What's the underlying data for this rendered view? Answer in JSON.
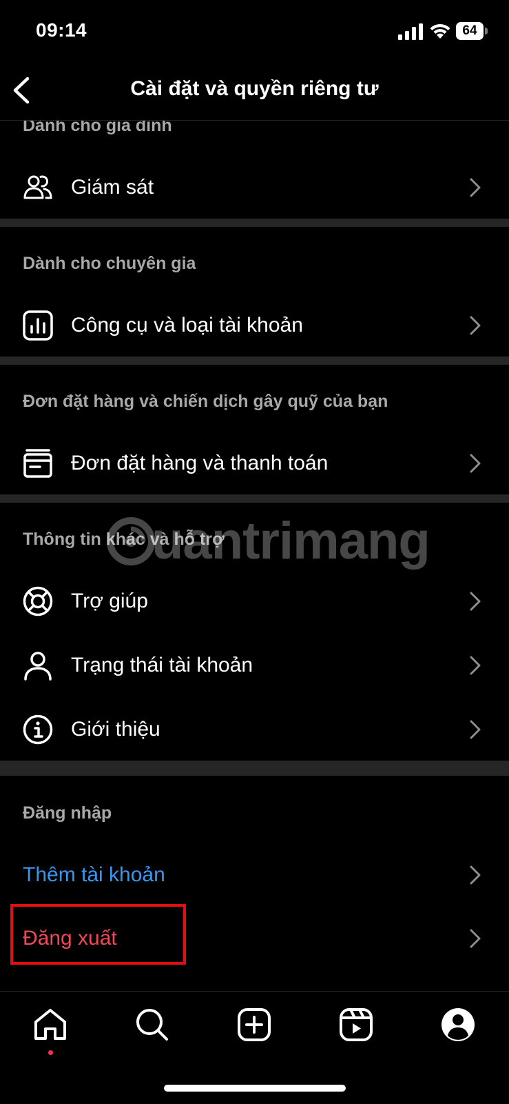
{
  "status": {
    "time": "09:14",
    "battery": "64"
  },
  "header": {
    "title": "Cài đặt và quyền riêng tư"
  },
  "sections": {
    "family": {
      "title": "Dành cho gia đình",
      "item": "Giám sát"
    },
    "pro": {
      "title": "Dành cho chuyên gia",
      "item": "Công cụ và loại tài khoản"
    },
    "orders": {
      "title": "Đơn đặt hàng và chiến dịch gây quỹ của bạn",
      "item": "Đơn đặt hàng và thanh toán"
    },
    "support": {
      "title": "Thông tin khác và hỗ trợ",
      "items": [
        "Trợ giúp",
        "Trạng thái tài khoản",
        "Giới thiệu"
      ]
    },
    "login": {
      "title": "Đăng nhập",
      "add_account": "Thêm tài khoản",
      "logout": "Đăng xuất"
    }
  },
  "watermark": "uantrimang",
  "colors": {
    "background": "#000000",
    "separator": "#262626",
    "link_blue": "#3797f0",
    "logout_red": "#ed4956",
    "section_gray": "#a8a8a8",
    "highlight": "#e01010"
  },
  "tabs": [
    "home-icon",
    "search-icon",
    "create-icon",
    "reels-icon",
    "profile-icon"
  ]
}
